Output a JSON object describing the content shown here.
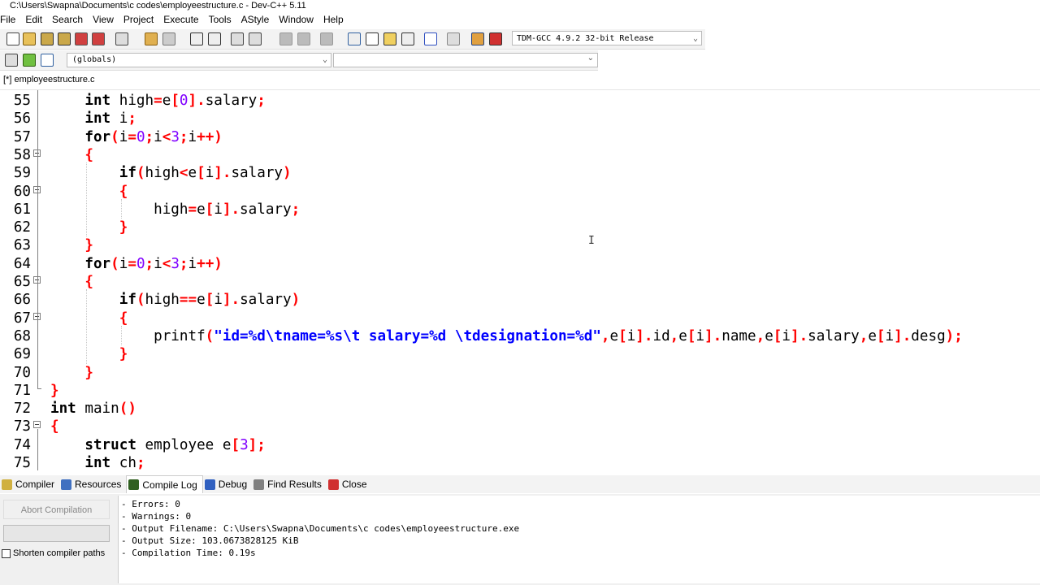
{
  "window": {
    "title": "C:\\Users\\Swapna\\Documents\\c codes\\employeestructure.c - Dev-C++ 5.11"
  },
  "menu": [
    "File",
    "Edit",
    "Search",
    "View",
    "Project",
    "Execute",
    "Tools",
    "AStyle",
    "Window",
    "Help"
  ],
  "toolbar": {
    "compiler": "TDM-GCC 4.9.2 32-bit Release",
    "scope": "(globals)",
    "function": ""
  },
  "editor_tab": "[*] employeestructure.c",
  "code_lines": [
    {
      "n": "55",
      "t": "    int high=e[0].salary;"
    },
    {
      "n": "56",
      "t": "    int i;"
    },
    {
      "n": "57",
      "t": "    for(i=0;i<3;i++)"
    },
    {
      "n": "58",
      "t": "    {"
    },
    {
      "n": "59",
      "t": "        if(high<e[i].salary)"
    },
    {
      "n": "60",
      "t": "        {"
    },
    {
      "n": "61",
      "t": "            high=e[i].salary;"
    },
    {
      "n": "62",
      "t": "        }"
    },
    {
      "n": "63",
      "t": "    }"
    },
    {
      "n": "64",
      "t": "    for(i=0;i<3;i++)"
    },
    {
      "n": "65",
      "t": "    {"
    },
    {
      "n": "66",
      "t": "        if(high==e[i].salary)"
    },
    {
      "n": "67",
      "t": "        {"
    },
    {
      "n": "68",
      "t": "            printf(\"id=%d\\tname=%s\\t salary=%d \\tdesignation=%d\",e[i].id,e[i].name,e[i].salary,e[i].desg);"
    },
    {
      "n": "69",
      "t": "        }"
    },
    {
      "n": "70",
      "t": "    }"
    },
    {
      "n": "71",
      "t": "}"
    },
    {
      "n": "72",
      "t": "int main()"
    },
    {
      "n": "73",
      "t": "{"
    },
    {
      "n": "74",
      "t": "    struct employee e[3];"
    },
    {
      "n": "75",
      "t": "    int ch;"
    }
  ],
  "bottom_tabs": [
    "Compiler",
    "Resources",
    "Compile Log",
    "Debug",
    "Find Results",
    "Close"
  ],
  "active_bottom_tab": "Compile Log",
  "abort_button": "Abort Compilation",
  "shorten_paths": "Shorten compiler paths",
  "log_lines": [
    "- Errors: 0",
    "- Warnings: 0",
    "- Output Filename: C:\\Users\\Swapna\\Documents\\c codes\\employeestructure.exe",
    "- Output Size: 103.0673828125 KiB",
    "- Compilation Time: 0.19s"
  ]
}
